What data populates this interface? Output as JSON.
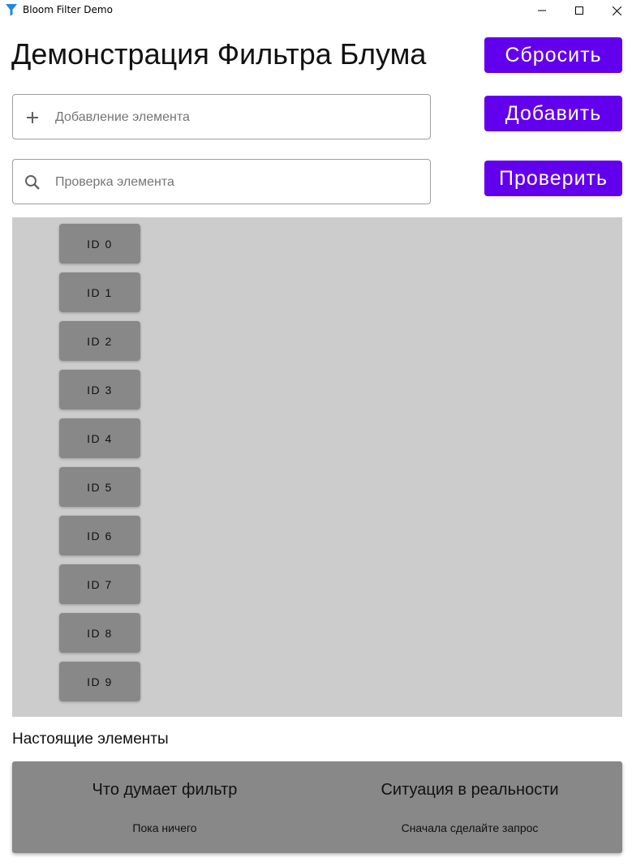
{
  "window": {
    "title": "Bloom Filter Demo",
    "icon": "funnel-icon",
    "accent": "#1e88e5"
  },
  "header": {
    "title": "Демонстрация Фильтра Блума",
    "reset_label": "Сбросить"
  },
  "add": {
    "placeholder": "Добавление элемента",
    "value": "",
    "icon": "plus-icon",
    "button_label": "Добавить"
  },
  "check": {
    "placeholder": "Проверка элемента",
    "value": "",
    "icon": "search-icon",
    "button_label": "Проверить"
  },
  "bits": [
    {
      "label": "ID 0"
    },
    {
      "label": "ID 1"
    },
    {
      "label": "ID 2"
    },
    {
      "label": "ID 3"
    },
    {
      "label": "ID 4"
    },
    {
      "label": "ID 5"
    },
    {
      "label": "ID 6"
    },
    {
      "label": "ID 7"
    },
    {
      "label": "ID 8"
    },
    {
      "label": "ID 9"
    }
  ],
  "section": {
    "label": "Настоящие элементы"
  },
  "results": {
    "filter_heading": "Что думает фильтр",
    "filter_value": "Пока ничего",
    "reality_heading": "Ситуация в реальности",
    "reality_value": "Сначала сделайте запрос"
  },
  "colors": {
    "primary": "#6200ee",
    "panel": "#cccccc",
    "bit": "#888888",
    "card": "#888888"
  }
}
